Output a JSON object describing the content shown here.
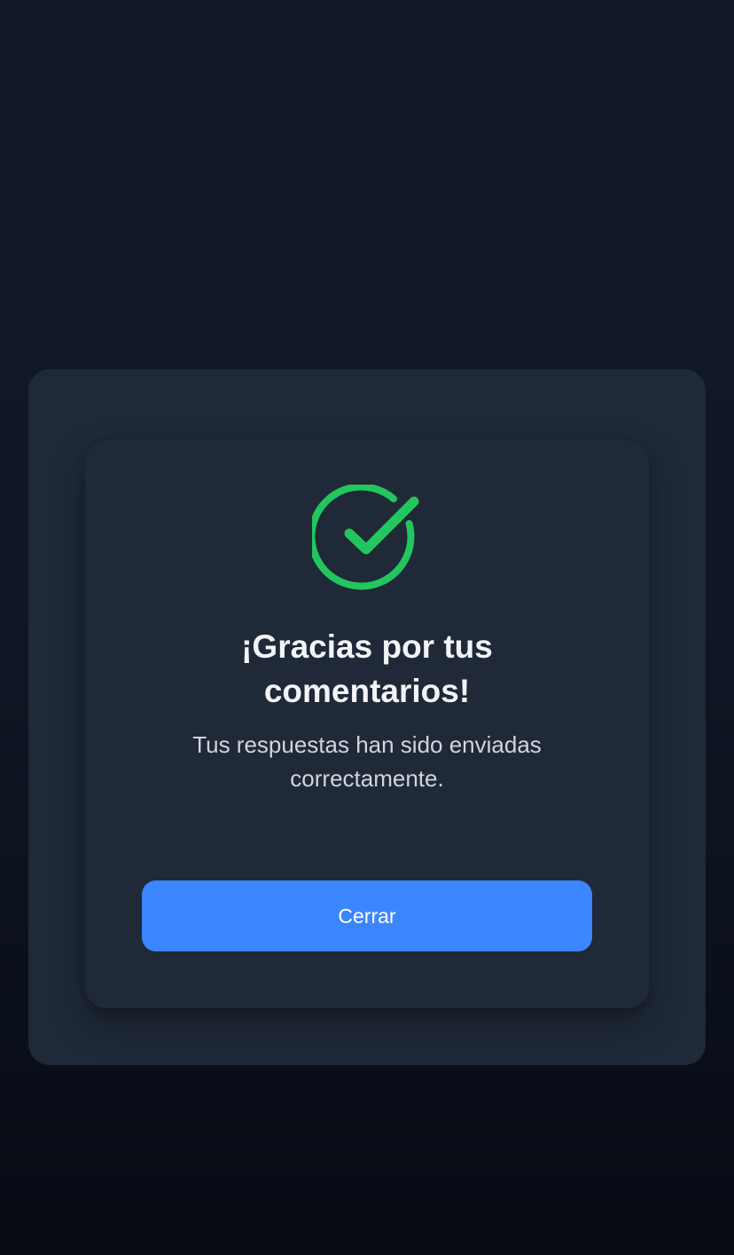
{
  "modal": {
    "icon": "check-circle-icon",
    "title": "¡Gracias por tus comentarios!",
    "message": "Tus respuestas han sido enviadas correctamente.",
    "close_label": "Cerrar"
  },
  "colors": {
    "background": "#111827",
    "card": "#1f2937",
    "success": "#22c55e",
    "primary": "#3b86ff",
    "title_text": "#f3f4f6",
    "message_text": "#d1d5db"
  }
}
